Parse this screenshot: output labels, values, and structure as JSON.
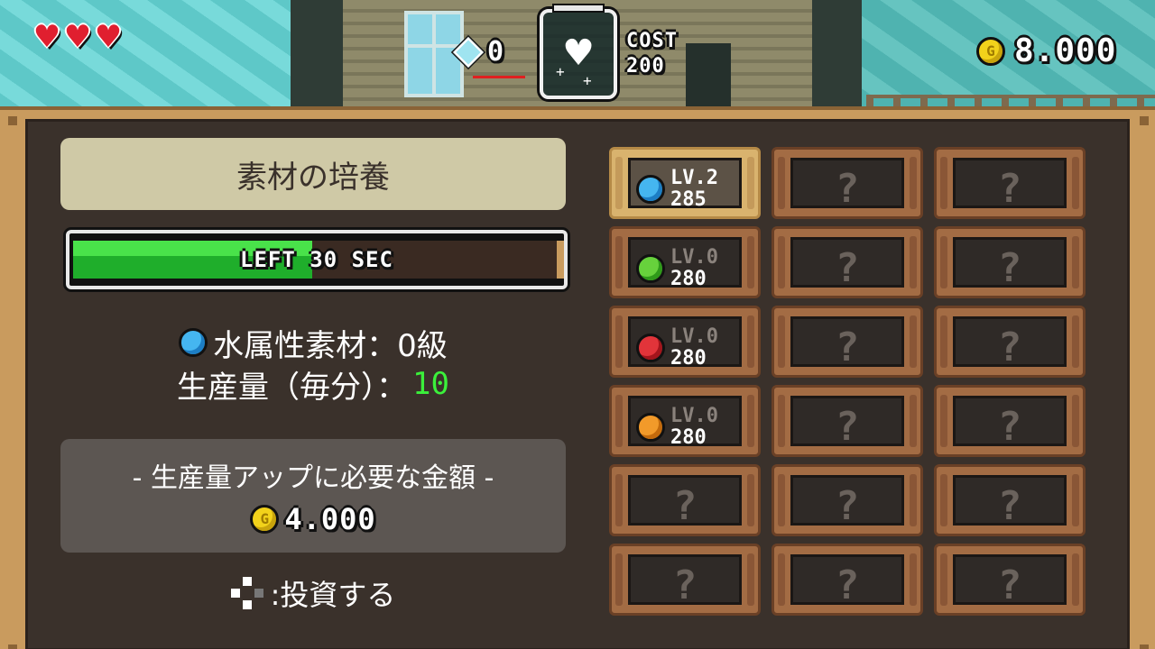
{
  "hud": {
    "hearts": 3,
    "gem_count": "0",
    "cost_label": "COST",
    "cost_value": "200",
    "gold": "8.000"
  },
  "panel": {
    "title": "素材の培養",
    "timer_label": "LEFT 30 SEC",
    "timer_fraction": 0.49,
    "material_line": "水属性素材：0級",
    "production_label": "生産量（毎分）：",
    "production_value": "10",
    "upgrade_heading": "- 生産量アップに必要な金額 -",
    "upgrade_cost": "4.000",
    "invest_hint": ":投資する"
  },
  "slots": [
    {
      "name": "water",
      "orb": "water-orb-icon",
      "level": "LV.2",
      "value": "285",
      "selected": true,
      "locked": false
    },
    {
      "locked": true,
      "label": "?"
    },
    {
      "locked": true,
      "label": "?"
    },
    {
      "name": "grass",
      "orb": "grass-orb-icon",
      "level": "LV.0",
      "value": "280",
      "selected": false,
      "locked": false
    },
    {
      "locked": true,
      "label": "?"
    },
    {
      "locked": true,
      "label": "?"
    },
    {
      "name": "fire",
      "orb": "fire-orb-icon",
      "level": "LV.0",
      "value": "280",
      "selected": false,
      "locked": false
    },
    {
      "locked": true,
      "label": "?"
    },
    {
      "locked": true,
      "label": "?"
    },
    {
      "name": "earth",
      "orb": "earth-orb-icon",
      "level": "LV.0",
      "value": "280",
      "selected": false,
      "locked": false
    },
    {
      "locked": true,
      "label": "?"
    },
    {
      "locked": true,
      "label": "?"
    },
    {
      "locked": true,
      "label": "?"
    },
    {
      "locked": true,
      "label": "?"
    },
    {
      "locked": true,
      "label": "?"
    },
    {
      "locked": true,
      "label": "?"
    },
    {
      "locked": true,
      "label": "?"
    },
    {
      "locked": true,
      "label": "?"
    }
  ],
  "colors": {
    "panel_wood": "#c99b5e",
    "panel_dark": "#3a312b",
    "timer_green": "#1fae2b",
    "production_green": "#3bf03b",
    "heart_red": "#e01f2f",
    "coin_yellow": "#f2d21b"
  }
}
